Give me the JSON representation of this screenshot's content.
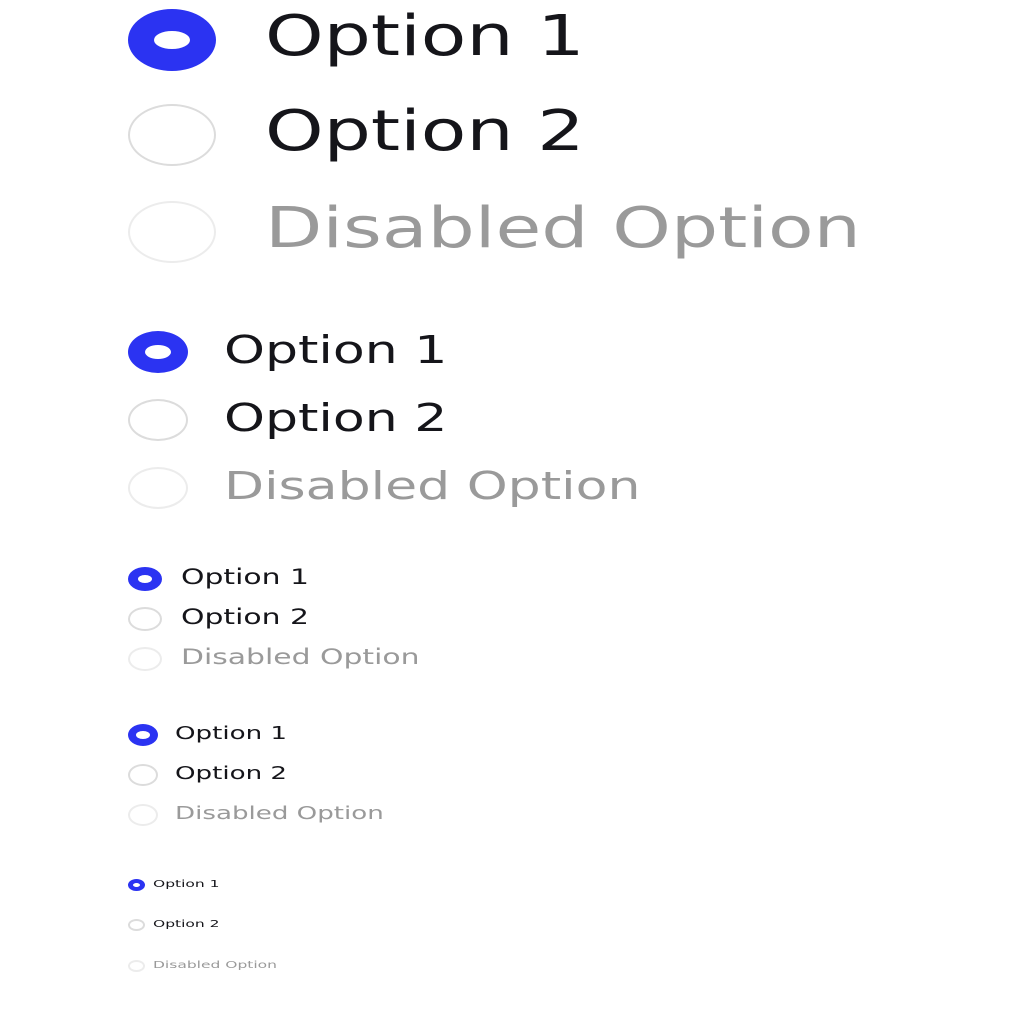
{
  "accent_color": "#2b33f2",
  "groups": [
    {
      "size": "xl",
      "options": [
        {
          "label": "Option 1",
          "state": "checked"
        },
        {
          "label": "Option 2",
          "state": "unchecked"
        },
        {
          "label": "Disabled Option",
          "state": "disabled"
        }
      ]
    },
    {
      "size": "lg",
      "options": [
        {
          "label": "Option 1",
          "state": "checked"
        },
        {
          "label": "Option 2",
          "state": "unchecked"
        },
        {
          "label": "Disabled Option",
          "state": "disabled"
        }
      ]
    },
    {
      "size": "md",
      "options": [
        {
          "label": "Option 1",
          "state": "checked"
        },
        {
          "label": "Option 2",
          "state": "unchecked"
        },
        {
          "label": "Disabled Option",
          "state": "disabled"
        }
      ]
    },
    {
      "size": "sm",
      "options": [
        {
          "label": "Option 1",
          "state": "checked"
        },
        {
          "label": "Option 2",
          "state": "unchecked"
        },
        {
          "label": "Disabled Option",
          "state": "disabled"
        }
      ]
    },
    {
      "size": "xs",
      "options": [
        {
          "label": "Option 1",
          "state": "checked"
        },
        {
          "label": "Option 2",
          "state": "unchecked"
        },
        {
          "label": "Disabled Option",
          "state": "disabled"
        }
      ]
    }
  ]
}
